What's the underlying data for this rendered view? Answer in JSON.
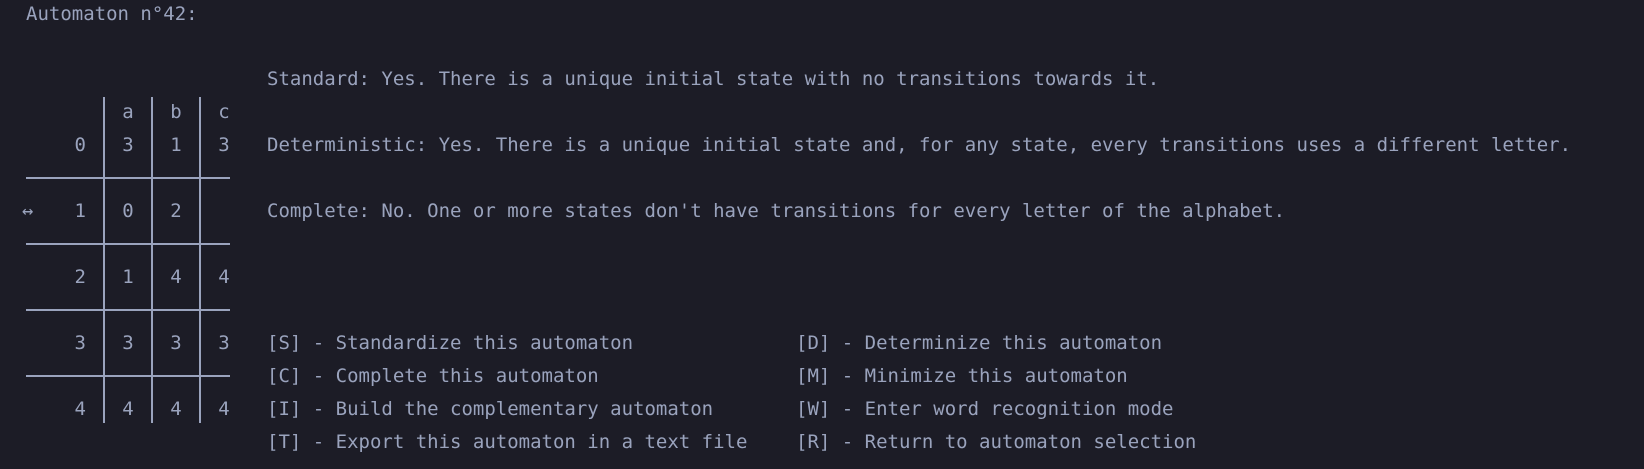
{
  "title": "Automaton n°42:",
  "table": {
    "columns": [
      "a",
      "b",
      "c"
    ],
    "rows": [
      {
        "state": "0",
        "marker": "",
        "cells": [
          "3",
          "1",
          "3"
        ]
      },
      {
        "state": "1",
        "marker": "↔",
        "cells": [
          "0",
          "2",
          ""
        ]
      },
      {
        "state": "2",
        "marker": "",
        "cells": [
          "1",
          "4",
          "4"
        ]
      },
      {
        "state": "3",
        "marker": "",
        "cells": [
          "3",
          "3",
          "3"
        ]
      },
      {
        "state": "4",
        "marker": "",
        "cells": [
          "4",
          "4",
          "4"
        ]
      }
    ]
  },
  "properties": {
    "standard": "Standard: Yes. There is a unique initial state with no transitions towards it.",
    "deterministic": "Deterministic: Yes. There is a unique initial state and, for any state, every transitions uses a different letter.",
    "complete": "Complete: No. One or more states don't have transitions for every letter of the alphabet."
  },
  "commands": {
    "standardize": "[S] - Standardize this automaton",
    "determinize": "[D] - Determinize this automaton",
    "complete": "[C] - Complete this automaton",
    "minimize": "[M] - Minimize this automaton",
    "complementary": "[I] - Build the complementary automaton",
    "word_recognition": "[W] - Enter word recognition mode",
    "export": "[T] - Export this automaton in a text file",
    "return": "[R] - Return to automaton selection"
  }
}
